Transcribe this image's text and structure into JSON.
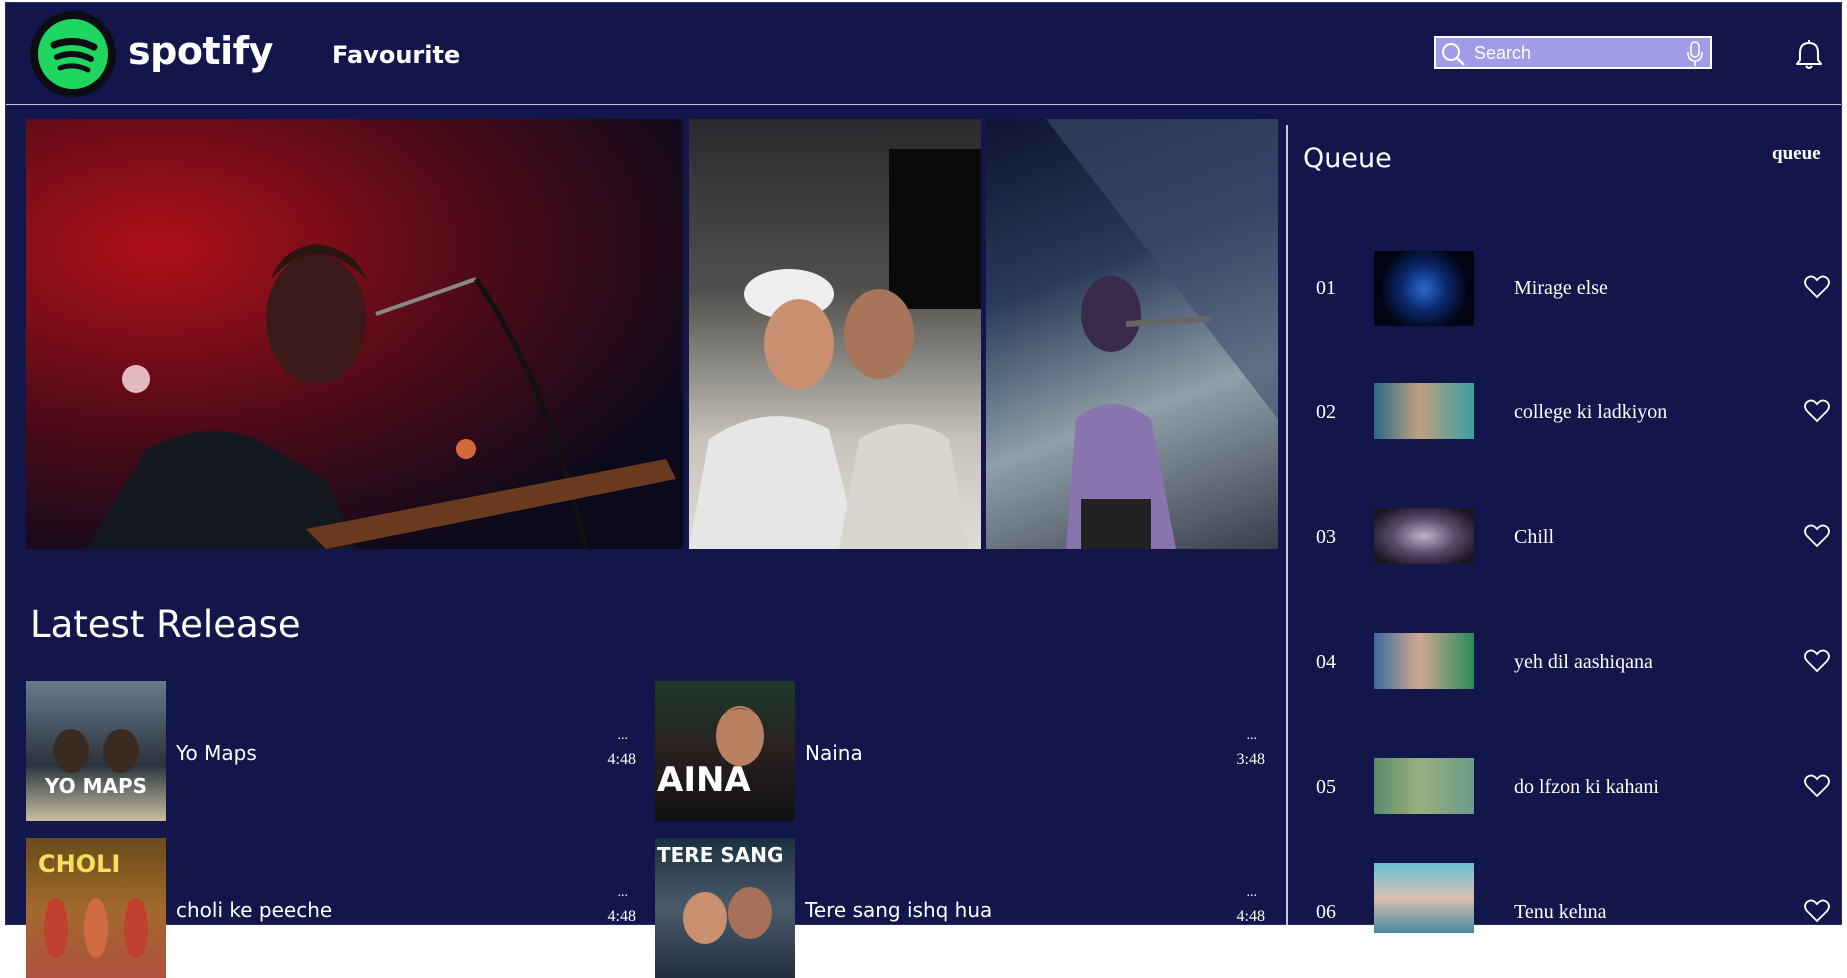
{
  "header": {
    "brand": "spotify",
    "nav_title": "Favourite",
    "search_placeholder": "Search"
  },
  "latest": {
    "title": "Latest Release",
    "items": [
      {
        "title": "Yo Maps",
        "dots": "...",
        "duration": "4:48",
        "thumb_text": "YO MAPS"
      },
      {
        "title": "Naina",
        "dots": "...",
        "duration": "3:48",
        "thumb_text": "AINA"
      },
      {
        "title": "choli ke peeche",
        "dots": "...",
        "duration": "4:48",
        "thumb_text": "CHOLI"
      },
      {
        "title": "Tere sang ishq hua",
        "dots": "...",
        "duration": "4:48",
        "thumb_text": "TERE SANG"
      }
    ]
  },
  "queue": {
    "title": "Queue",
    "link": "queue",
    "items": [
      {
        "num": "01",
        "title": "Mirage else"
      },
      {
        "num": "02",
        "title": "college ki ladkiyon"
      },
      {
        "num": "03",
        "title": "Chill"
      },
      {
        "num": "04",
        "title": "yeh dil aashiqana"
      },
      {
        "num": "05",
        "title": "do lfzon ki kahani"
      },
      {
        "num": "06",
        "title": "Tenu kehna"
      }
    ]
  },
  "colors": {
    "background": "#13164a",
    "search_bg": "#a09ce8",
    "brand_green": "#1ed760"
  }
}
